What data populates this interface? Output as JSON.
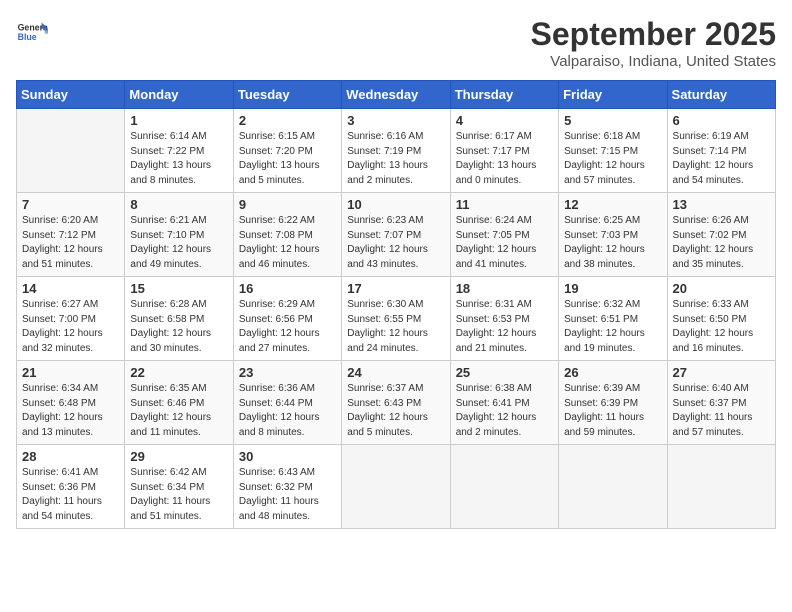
{
  "header": {
    "logo": {
      "general": "General",
      "blue": "Blue"
    },
    "month": "September 2025",
    "location": "Valparaiso, Indiana, United States"
  },
  "weekdays": [
    "Sunday",
    "Monday",
    "Tuesday",
    "Wednesday",
    "Thursday",
    "Friday",
    "Saturday"
  ],
  "weeks": [
    [
      {
        "day": "",
        "info": ""
      },
      {
        "day": "1",
        "info": "Sunrise: 6:14 AM\nSunset: 7:22 PM\nDaylight: 13 hours\nand 8 minutes."
      },
      {
        "day": "2",
        "info": "Sunrise: 6:15 AM\nSunset: 7:20 PM\nDaylight: 13 hours\nand 5 minutes."
      },
      {
        "day": "3",
        "info": "Sunrise: 6:16 AM\nSunset: 7:19 PM\nDaylight: 13 hours\nand 2 minutes."
      },
      {
        "day": "4",
        "info": "Sunrise: 6:17 AM\nSunset: 7:17 PM\nDaylight: 13 hours\nand 0 minutes."
      },
      {
        "day": "5",
        "info": "Sunrise: 6:18 AM\nSunset: 7:15 PM\nDaylight: 12 hours\nand 57 minutes."
      },
      {
        "day": "6",
        "info": "Sunrise: 6:19 AM\nSunset: 7:14 PM\nDaylight: 12 hours\nand 54 minutes."
      }
    ],
    [
      {
        "day": "7",
        "info": "Sunrise: 6:20 AM\nSunset: 7:12 PM\nDaylight: 12 hours\nand 51 minutes."
      },
      {
        "day": "8",
        "info": "Sunrise: 6:21 AM\nSunset: 7:10 PM\nDaylight: 12 hours\nand 49 minutes."
      },
      {
        "day": "9",
        "info": "Sunrise: 6:22 AM\nSunset: 7:08 PM\nDaylight: 12 hours\nand 46 minutes."
      },
      {
        "day": "10",
        "info": "Sunrise: 6:23 AM\nSunset: 7:07 PM\nDaylight: 12 hours\nand 43 minutes."
      },
      {
        "day": "11",
        "info": "Sunrise: 6:24 AM\nSunset: 7:05 PM\nDaylight: 12 hours\nand 41 minutes."
      },
      {
        "day": "12",
        "info": "Sunrise: 6:25 AM\nSunset: 7:03 PM\nDaylight: 12 hours\nand 38 minutes."
      },
      {
        "day": "13",
        "info": "Sunrise: 6:26 AM\nSunset: 7:02 PM\nDaylight: 12 hours\nand 35 minutes."
      }
    ],
    [
      {
        "day": "14",
        "info": "Sunrise: 6:27 AM\nSunset: 7:00 PM\nDaylight: 12 hours\nand 32 minutes."
      },
      {
        "day": "15",
        "info": "Sunrise: 6:28 AM\nSunset: 6:58 PM\nDaylight: 12 hours\nand 30 minutes."
      },
      {
        "day": "16",
        "info": "Sunrise: 6:29 AM\nSunset: 6:56 PM\nDaylight: 12 hours\nand 27 minutes."
      },
      {
        "day": "17",
        "info": "Sunrise: 6:30 AM\nSunset: 6:55 PM\nDaylight: 12 hours\nand 24 minutes."
      },
      {
        "day": "18",
        "info": "Sunrise: 6:31 AM\nSunset: 6:53 PM\nDaylight: 12 hours\nand 21 minutes."
      },
      {
        "day": "19",
        "info": "Sunrise: 6:32 AM\nSunset: 6:51 PM\nDaylight: 12 hours\nand 19 minutes."
      },
      {
        "day": "20",
        "info": "Sunrise: 6:33 AM\nSunset: 6:50 PM\nDaylight: 12 hours\nand 16 minutes."
      }
    ],
    [
      {
        "day": "21",
        "info": "Sunrise: 6:34 AM\nSunset: 6:48 PM\nDaylight: 12 hours\nand 13 minutes."
      },
      {
        "day": "22",
        "info": "Sunrise: 6:35 AM\nSunset: 6:46 PM\nDaylight: 12 hours\nand 11 minutes."
      },
      {
        "day": "23",
        "info": "Sunrise: 6:36 AM\nSunset: 6:44 PM\nDaylight: 12 hours\nand 8 minutes."
      },
      {
        "day": "24",
        "info": "Sunrise: 6:37 AM\nSunset: 6:43 PM\nDaylight: 12 hours\nand 5 minutes."
      },
      {
        "day": "25",
        "info": "Sunrise: 6:38 AM\nSunset: 6:41 PM\nDaylight: 12 hours\nand 2 minutes."
      },
      {
        "day": "26",
        "info": "Sunrise: 6:39 AM\nSunset: 6:39 PM\nDaylight: 11 hours\nand 59 minutes."
      },
      {
        "day": "27",
        "info": "Sunrise: 6:40 AM\nSunset: 6:37 PM\nDaylight: 11 hours\nand 57 minutes."
      }
    ],
    [
      {
        "day": "28",
        "info": "Sunrise: 6:41 AM\nSunset: 6:36 PM\nDaylight: 11 hours\nand 54 minutes."
      },
      {
        "day": "29",
        "info": "Sunrise: 6:42 AM\nSunset: 6:34 PM\nDaylight: 11 hours\nand 51 minutes."
      },
      {
        "day": "30",
        "info": "Sunrise: 6:43 AM\nSunset: 6:32 PM\nDaylight: 11 hours\nand 48 minutes."
      },
      {
        "day": "",
        "info": ""
      },
      {
        "day": "",
        "info": ""
      },
      {
        "day": "",
        "info": ""
      },
      {
        "day": "",
        "info": ""
      }
    ]
  ]
}
